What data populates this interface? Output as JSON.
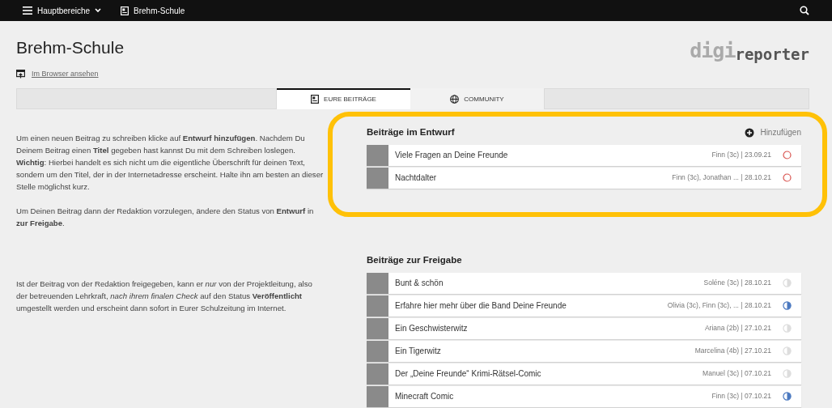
{
  "navbar": {
    "menu_label": "Hauptbereiche",
    "school": "Brehm-Schule"
  },
  "logo": {
    "prefix": "digi",
    "suffix": "reporter"
  },
  "page": {
    "title": "Brehm-Schule",
    "browser_link": "Im Browser ansehen"
  },
  "tabs": [
    {
      "label": "EURE BEITRÄGE",
      "selected": true
    },
    {
      "label": "COMMUNITY",
      "selected": false
    }
  ],
  "info": {
    "paragraphs": [
      "Um einen neuen Beitrag zu schreiben klicke auf **Entwurf hinzufügen**. Nachdem Du Deinem Beitrag einen **Titel** gegeben hast kannst Du mit dem Schreiben loslegen. **Wichtig**: Hierbei handelt es sich nicht um die eigentliche Überschrift für deinen Text, sondern um den Titel, der in der Internetadresse erscheint. Halte ihn am besten an dieser Stelle möglichst kurz.",
      "Um Deinen Beitrag dann der Redaktion vorzulegen, ändere den Status von **Entwurf** in **zur Freigabe**.",
      "Ist der Beitrag von der Redaktion freigegeben, kann er *nur* von der Projektleitung, also der betreuenden Lehrkraft, *nach ihrem finalen Check* auf den Status **Veröffentlicht** umgestellt werden und erscheint dann sofort in Eurer Schulzeitung im Internet."
    ]
  },
  "drafts": {
    "title": "Beiträge im Entwurf",
    "add_label": "Hinzufügen",
    "highlighted": true,
    "items": [
      {
        "title": "Viele Fragen an Deine Freunde",
        "meta": "Finn (3c) | 23.09.21",
        "kind": "draft",
        "active": false
      },
      {
        "title": "Nachtdalter",
        "meta": "Finn (3c), Jonathan ... | 28.10.21",
        "kind": "draft",
        "active": false
      }
    ]
  },
  "review": {
    "title": "Beiträge zur Freigabe",
    "items": [
      {
        "title": "Bunt & schön",
        "meta": "Soléne (3c) | 28.10.21",
        "kind": "review",
        "active": false
      },
      {
        "title": "Erfahre hier mehr über die Band Deine Freunde",
        "meta": "Olivia (3c), Finn (3c), ... | 28.10.21",
        "kind": "review",
        "active": true
      },
      {
        "title": "Ein Geschwisterwitz",
        "meta": "Ariana (2b) | 27.10.21",
        "kind": "review",
        "active": false
      },
      {
        "title": "Ein Tigerwitz",
        "meta": "Marcelina (4b) | 27.10.21",
        "kind": "review",
        "active": false
      },
      {
        "title": "Der „Deine Freunde“ Krimi-Rätsel-Comic",
        "meta": "Manuel (3c) | 07.10.21",
        "kind": "review",
        "active": false
      },
      {
        "title": "Minecraft Comic",
        "meta": "Finn (3c) | 07.10.21",
        "kind": "review",
        "active": true
      }
    ]
  }
}
